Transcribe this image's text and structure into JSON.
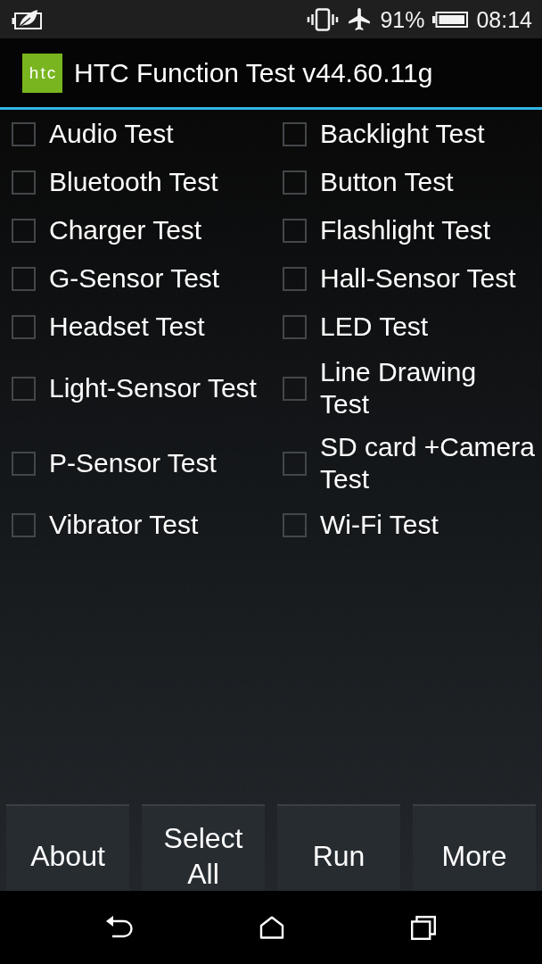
{
  "status_bar": {
    "battery_percent": "91%",
    "time": "08:14"
  },
  "app_bar": {
    "logo_text": "htc",
    "title": "HTC Function Test v44.60.11g"
  },
  "tests": [
    {
      "label": "Audio Test",
      "checked": false
    },
    {
      "label": "Bluetooth Test",
      "checked": false
    },
    {
      "label": "Charger Test",
      "checked": false
    },
    {
      "label": "G-Sensor Test",
      "checked": false
    },
    {
      "label": "Headset Test",
      "checked": false
    },
    {
      "label": "Light-Sensor Test",
      "checked": false
    },
    {
      "label": "P-Sensor Test",
      "checked": false
    },
    {
      "label": "Vibrator Test",
      "checked": false
    },
    {
      "label": "Backlight Test",
      "checked": false
    },
    {
      "label": "Button Test",
      "checked": false
    },
    {
      "label": "Flashlight Test",
      "checked": false
    },
    {
      "label": "Hall-Sensor Test",
      "checked": false
    },
    {
      "label": "LED Test",
      "checked": false
    },
    {
      "label": "Line Drawing\nTest",
      "checked": false
    },
    {
      "label": "SD card +Camera\nTest",
      "checked": false
    },
    {
      "label": "Wi-Fi Test",
      "checked": false
    }
  ],
  "buttons": [
    "About",
    "Select All",
    "Run",
    "More"
  ]
}
